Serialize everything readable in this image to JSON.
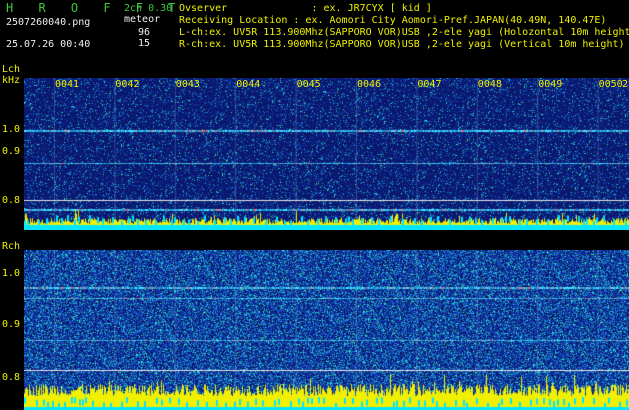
{
  "header": {
    "app_title": "H R O F F T",
    "mode": "2ch 0.30",
    "filename": "2507260040.png",
    "meteor_label": "meteor",
    "meteor_lch": "96",
    "meteor_rch": "15",
    "datetime": "25.07.26 00:40",
    "observer": "Ovserver              : ex. JR7CYX [ kid ]",
    "location": "Receiving Location : ex. Aomori City Aomori-Pref.JAPAN(40.49N, 140.47E)",
    "lch_info": "L-ch:ex. UV5R 113.900Mhz(SAPPORO VOR)USB ,2-ele yagi (Holozontal 10m height",
    "rch_info": "R-ch:ex. UV5R 113.900Mhz(SAPPORO VOR)USB ,2-ele yagi (Vertical 10m height)"
  },
  "lch": {
    "label": "Lch",
    "unit": "kHz",
    "ticks": [
      "1.0",
      "0.9",
      "0.8"
    ]
  },
  "rch": {
    "label": "Rch",
    "ticks": [
      "1.0",
      "0.9",
      "0.8"
    ]
  },
  "minutes": [
    "0041",
    "0042",
    "0043",
    "0044",
    "0045",
    "0046",
    "0047",
    "0048",
    "0049",
    "0050",
    "2"
  ],
  "colors": {
    "background": "#0b1a70",
    "yellow": "#f0f000",
    "cyan": "#00e6ff",
    "green": "#3ec83e"
  }
}
